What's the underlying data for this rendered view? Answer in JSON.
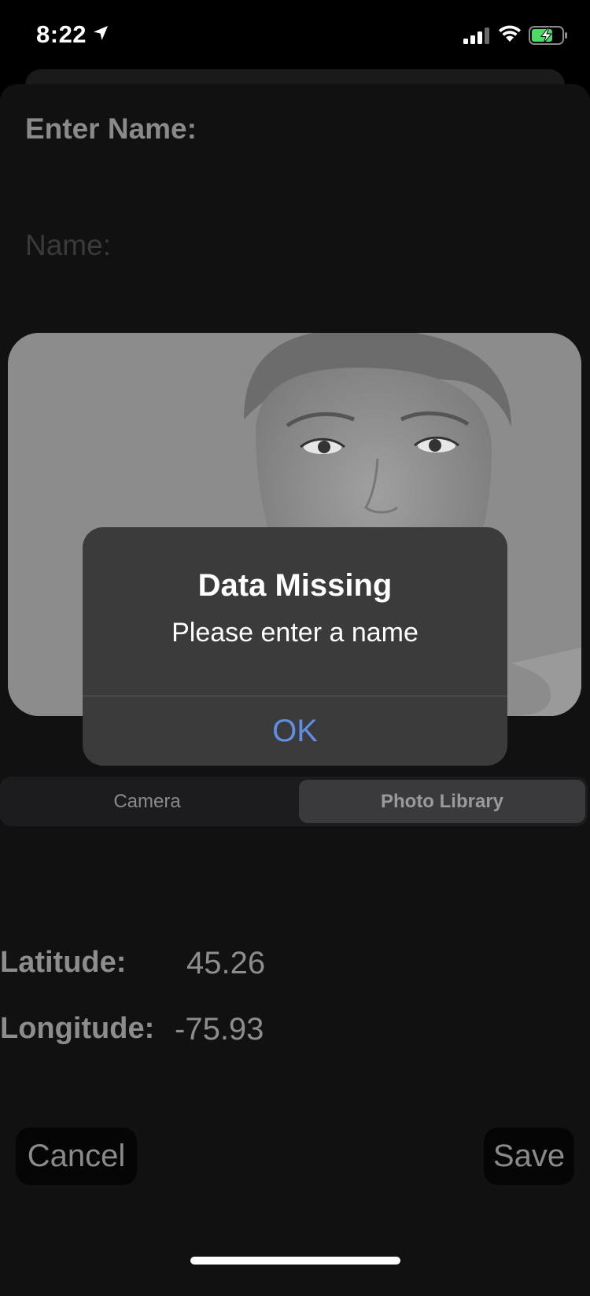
{
  "status_bar": {
    "time": "8:22"
  },
  "form": {
    "heading": "Enter Name:",
    "name_placeholder": "Name:"
  },
  "alert": {
    "title": "Data Missing",
    "message": "Please enter a name",
    "ok_label": "OK",
    "ok_color": "#5f8ee4"
  },
  "source_picker": {
    "options": [
      "Camera",
      "Photo Library"
    ],
    "selected": "Photo Library"
  },
  "location": {
    "latitude_label": "Latitude:",
    "latitude_value": "45.26",
    "longitude_label": "Longitude:",
    "longitude_value": "-75.93"
  },
  "actions": {
    "cancel_label": "Cancel",
    "save_label": "Save"
  },
  "icons": [
    "location-arrow-icon",
    "cellular-signal-icon",
    "wifi-icon",
    "battery-charging-icon"
  ]
}
